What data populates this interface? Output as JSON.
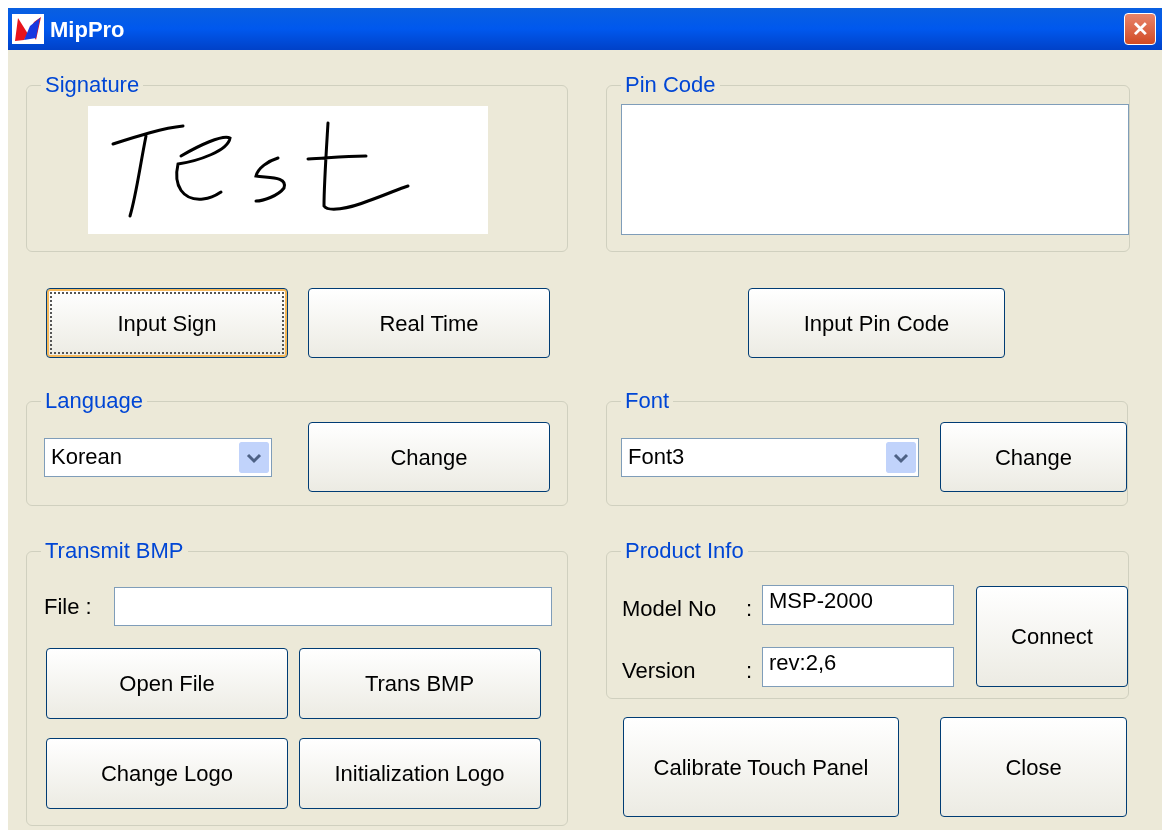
{
  "window": {
    "title": "MipPro",
    "close_glyph": "✕"
  },
  "signature": {
    "legend": "Signature"
  },
  "pin_code": {
    "legend": "Pin Code"
  },
  "signature_buttons": [
    {
      "label": "Input Sign",
      "focused": true
    },
    {
      "label": "Real Time",
      "focused": false
    }
  ],
  "pin_button": {
    "label": "Input Pin Code",
    "focused": false
  },
  "language": {
    "legend": "Language",
    "value": "Korean",
    "button": {
      "label": "Change",
      "focused": false
    }
  },
  "font": {
    "legend": "Font",
    "value": "Font3",
    "button": {
      "label": "Change",
      "focused": false
    }
  },
  "transmit_bmp": {
    "legend": "Transmit BMP",
    "file_label": "File :",
    "buttons": [
      {
        "label": "Open File",
        "focused": false
      },
      {
        "label": "Trans BMP",
        "focused": false
      },
      {
        "label": "Change Logo",
        "focused": false
      },
      {
        "label": "Initialization Logo",
        "focused": false
      }
    ]
  },
  "product_info": {
    "legend": "Product Info",
    "fields": [
      {
        "label": "Model No",
        "colon": ":",
        "value": "MSP-2000"
      },
      {
        "label": "Version",
        "colon": ":",
        "value": "rev:2,6"
      }
    ],
    "button": {
      "label": "Connect",
      "focused": false
    }
  },
  "bottom_buttons": [
    {
      "label": "Calibrate Touch Panel",
      "focused": false
    },
    {
      "label": "Close",
      "focused": false
    }
  ]
}
